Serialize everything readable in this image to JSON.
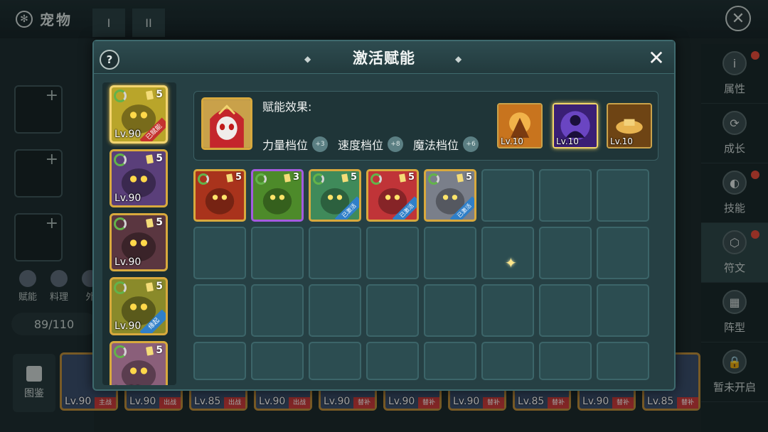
{
  "background": {
    "title": "宠物",
    "tabs": [
      "I",
      "II"
    ],
    "small_icons": [
      "赋能",
      "料理",
      "外"
    ],
    "count": "89/110",
    "book_label": "图鉴",
    "bottom_cards": [
      {
        "level": "Lv.90",
        "ribbon": "主战"
      },
      {
        "level": "Lv.90",
        "ribbon": "出战"
      },
      {
        "level": "Lv.85",
        "ribbon": "出战"
      },
      {
        "level": "Lv.90",
        "ribbon": "出战"
      },
      {
        "level": "Lv.90",
        "ribbon": "替补"
      },
      {
        "level": "Lv.90",
        "ribbon": "替补"
      },
      {
        "level": "Lv.90",
        "ribbon": "替补"
      },
      {
        "level": "Lv.85",
        "ribbon": "替补"
      },
      {
        "level": "Lv.90",
        "ribbon": "替补"
      },
      {
        "level": "Lv.85",
        "ribbon": "替补"
      }
    ],
    "nav": [
      {
        "label": "属性",
        "icon": "i",
        "dot": true
      },
      {
        "label": "成长",
        "icon": "⟳",
        "dot": false
      },
      {
        "label": "技能",
        "icon": "◐",
        "dot": true
      },
      {
        "label": "符文",
        "icon": "⬡",
        "dot": true,
        "active": true
      },
      {
        "label": "阵型",
        "icon": "▦",
        "dot": false
      },
      {
        "label": "暂未开启",
        "icon": "🔒",
        "dot": false
      }
    ]
  },
  "modal": {
    "help": "?",
    "title": "激活赋能",
    "close": "✕",
    "effect_label": "赋能效果:",
    "stats": [
      {
        "label": "力量档位",
        "value": "+3"
      },
      {
        "label": "速度档位",
        "value": "+8"
      },
      {
        "label": "魔法档位",
        "value": "+6"
      }
    ],
    "talents": [
      {
        "level": "Lv.10",
        "color": "#c8741e"
      },
      {
        "level": "Lv.10",
        "color": "#4a2a8a"
      },
      {
        "level": "Lv.10",
        "color": "#8a5a1a"
      }
    ],
    "pet_list": [
      {
        "level": "Lv.90",
        "stars": "5",
        "ribbon": "已赋能",
        "ribbon_color": "red",
        "color": "#b9a52a",
        "selected": true
      },
      {
        "level": "Lv.90",
        "stars": "5",
        "ribbon": "",
        "ribbon_color": "",
        "color": "#5a3f7a"
      },
      {
        "level": "Lv.90",
        "stars": "5",
        "ribbon": "",
        "ribbon_color": "",
        "color": "#5a3640"
      },
      {
        "level": "Lv.90",
        "stars": "5",
        "ribbon": "缘起",
        "ribbon_color": "blue",
        "color": "#8a8a2a"
      },
      {
        "level": "Lv.90",
        "stars": "5",
        "ribbon": "",
        "ribbon_color": "",
        "color": "#8a5f7a"
      }
    ],
    "grid_pets": [
      {
        "stars": "5",
        "ribbon": "",
        "color": "#a9331c",
        "purple": false
      },
      {
        "stars": "3",
        "ribbon": "",
        "color": "#4d8a2a",
        "purple": true
      },
      {
        "stars": "5",
        "ribbon": "已激活",
        "color": "#3f8a5a",
        "purple": false
      },
      {
        "stars": "5",
        "ribbon": "已激活",
        "color": "#c03438",
        "purple": false
      },
      {
        "stars": "5",
        "ribbon": "已激活",
        "color": "#7a7f8a",
        "purple": false
      }
    ]
  }
}
